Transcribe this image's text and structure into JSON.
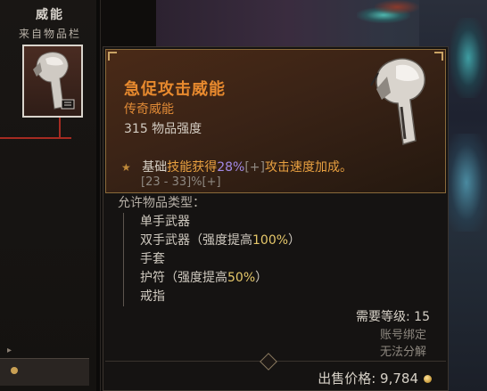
{
  "slot": {
    "title": "威能",
    "subtitle": "来自物品栏"
  },
  "tooltip": {
    "name": "急促攻击威能",
    "rarity": "传奇威能",
    "power": "315 物品强度",
    "affix": {
      "prefix": "基础",
      "skill_text": "技能获得",
      "value": "28%",
      "bracket": "[+]",
      "effect": "攻击速度加成。",
      "range": "[23 - 33]%[+]"
    },
    "types_label": "允许物品类型：",
    "types": [
      {
        "name": "单手武器",
        "extra_open": "",
        "extra_text": "",
        "extra_value": "",
        "extra_close": ""
      },
      {
        "name": "双手武器",
        "extra_open": "（",
        "extra_text": "强度提高",
        "extra_value": "100%",
        "extra_close": "）"
      },
      {
        "name": "手套",
        "extra_open": "",
        "extra_text": "",
        "extra_value": "",
        "extra_close": ""
      },
      {
        "name": "护符",
        "extra_open": "（",
        "extra_text": "强度提高",
        "extra_value": "50%",
        "extra_close": "）"
      },
      {
        "name": "戒指",
        "extra_open": "",
        "extra_text": "",
        "extra_value": "",
        "extra_close": ""
      }
    ],
    "required_level": "需要等级: 15",
    "bound": "账号绑定",
    "unsalvageable": "无法分解",
    "sell_price_label": "出售价格:",
    "sell_price_value": "9,784"
  },
  "icons": {
    "aspect_item": "axe-aspect-icon",
    "gold": "gold-coin-icon"
  },
  "colors": {
    "legendary_orange": "#e88a2e",
    "highlight_purple": "#a28ae6",
    "highlight_gold": "#e6c86a",
    "link_red": "#a52b22"
  }
}
